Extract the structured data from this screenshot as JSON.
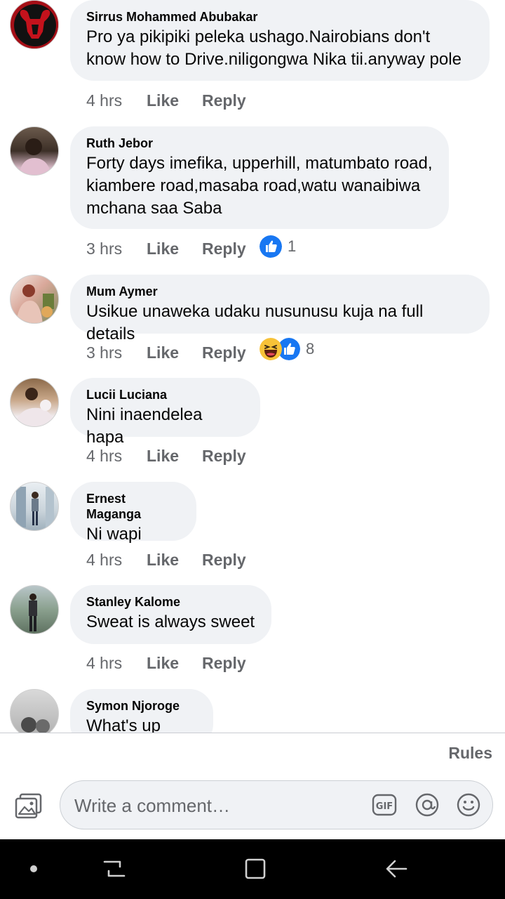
{
  "comments": [
    {
      "author": "Sirrus Mohammed Abubakar",
      "text": "Pro ya pikipiki peleka ushago.Nairobians don't know how to Drive.niligongwa Nika tii.anyway pole",
      "time": "4 hrs",
      "like": "Like",
      "reply": "Reply"
    },
    {
      "author": "Ruth Jebor",
      "text": "Forty days imefika, upperhill, matumbato road, kiambere road,masaba road,watu wanaibiwa mchana saa Saba",
      "time": "3 hrs",
      "like": "Like",
      "reply": "Reply",
      "reaction_count": "1"
    },
    {
      "author": "Mum Aymer",
      "text": "Usikue unaweka udaku nusunusu kuja na full details",
      "time": "3 hrs",
      "like": "Like",
      "reply": "Reply",
      "reaction_count": "8"
    },
    {
      "author": "Lucii Luciana",
      "text": "Nini inaendelea hapa",
      "time": "4 hrs",
      "like": "Like",
      "reply": "Reply"
    },
    {
      "author": "Ernest Maganga",
      "text": "Ni wapi",
      "time": "4 hrs",
      "like": "Like",
      "reply": "Reply"
    },
    {
      "author": "Stanley Kalome",
      "text": "Sweat is always sweet",
      "time": "4 hrs",
      "like": "Like",
      "reply": "Reply"
    },
    {
      "author": "Symon Njoroge",
      "text": "What's up here"
    }
  ],
  "rules_label": "Rules",
  "composer": {
    "placeholder": "Write a comment…"
  },
  "icons": {
    "photo": "photo-icon",
    "gif": "gif-icon",
    "mention": "at-mention-icon",
    "emoji": "emoji-icon",
    "like_reaction": "like-reaction-icon",
    "haha_reaction": "haha-reaction-icon",
    "nav_home": "home-dot-icon",
    "nav_recents": "recents-icon",
    "nav_overview": "overview-icon",
    "nav_back": "back-icon"
  },
  "colors": {
    "bubble": "#f0f2f5",
    "meta_text": "#65676b",
    "like_blue": "#1877f2",
    "nav_bg": "#000000"
  }
}
